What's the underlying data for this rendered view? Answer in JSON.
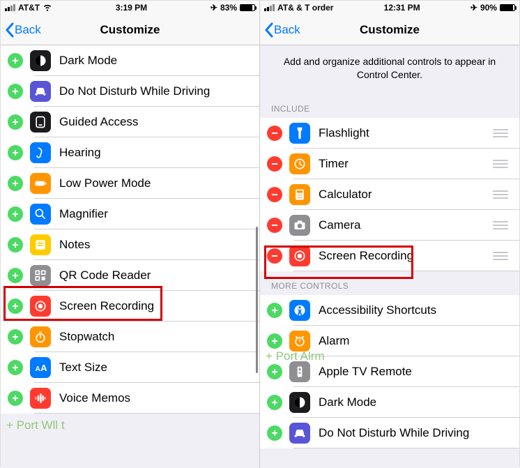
{
  "left": {
    "status": {
      "carrier": "AT&T",
      "time": "3:19 PM",
      "battery_pct": "83%",
      "nav_icon": "✈"
    },
    "nav": {
      "back": "Back",
      "title": "Customize"
    },
    "items": [
      {
        "label": "Dark Mode",
        "icon": "dark-mode",
        "bg": "#1c1c1e"
      },
      {
        "label": "Do Not Disturb While Driving",
        "icon": "car",
        "bg": "#5856d6"
      },
      {
        "label": "Guided Access",
        "icon": "guided",
        "bg": "#1c1c1e"
      },
      {
        "label": "Hearing",
        "icon": "ear",
        "bg": "#007aff"
      },
      {
        "label": "Low Power Mode",
        "icon": "battery",
        "bg": "#ff9500"
      },
      {
        "label": "Magnifier",
        "icon": "magnifier",
        "bg": "#007aff"
      },
      {
        "label": "Notes",
        "icon": "notes",
        "bg": "#ffcc00"
      },
      {
        "label": "QR Code Reader",
        "icon": "qr",
        "bg": "#8e8e93"
      },
      {
        "label": "Screen Recording",
        "icon": "record",
        "bg": "#ff3b30"
      },
      {
        "label": "Stopwatch",
        "icon": "stopwatch",
        "bg": "#ff9500"
      },
      {
        "label": "Text Size",
        "icon": "textsize",
        "bg": "#007aff"
      },
      {
        "label": "Voice Memos",
        "icon": "voice",
        "bg": "#ff3b30"
      }
    ],
    "watermark": "+ Port Wll t"
  },
  "right": {
    "status": {
      "carrier": "AT& & T order",
      "time": "12:31 PM",
      "battery_pct": "90%",
      "nav_icon": "✈"
    },
    "nav": {
      "back": "Back",
      "title": "Customize"
    },
    "info": "Add and organize additional controls to appear in Control Center.",
    "section_include": "INCLUDE",
    "include": [
      {
        "label": "Flashlight",
        "icon": "flashlight",
        "bg": "#007aff"
      },
      {
        "label": "Timer",
        "icon": "timer",
        "bg": "#ff9500"
      },
      {
        "label": "Calculator",
        "icon": "calculator",
        "bg": "#ff9500"
      },
      {
        "label": "Camera",
        "icon": "camera",
        "bg": "#8e8e93"
      },
      {
        "label": "Screen Recording",
        "icon": "record",
        "bg": "#ff3b30"
      }
    ],
    "section_more": "MORE CONTROLS",
    "more": [
      {
        "label": "Accessibility Shortcuts",
        "icon": "access",
        "bg": "#007aff"
      },
      {
        "label": "Alarm",
        "icon": "alarm",
        "bg": "#ff9500"
      },
      {
        "label": "Apple TV Remote",
        "icon": "remote",
        "bg": "#8e8e93"
      },
      {
        "label": "Dark Mode",
        "icon": "dark-mode",
        "bg": "#1c1c1e"
      },
      {
        "label": "Do Not Disturb While Driving",
        "icon": "car",
        "bg": "#5856d6"
      }
    ],
    "watermark": "+ Port Alrm"
  }
}
